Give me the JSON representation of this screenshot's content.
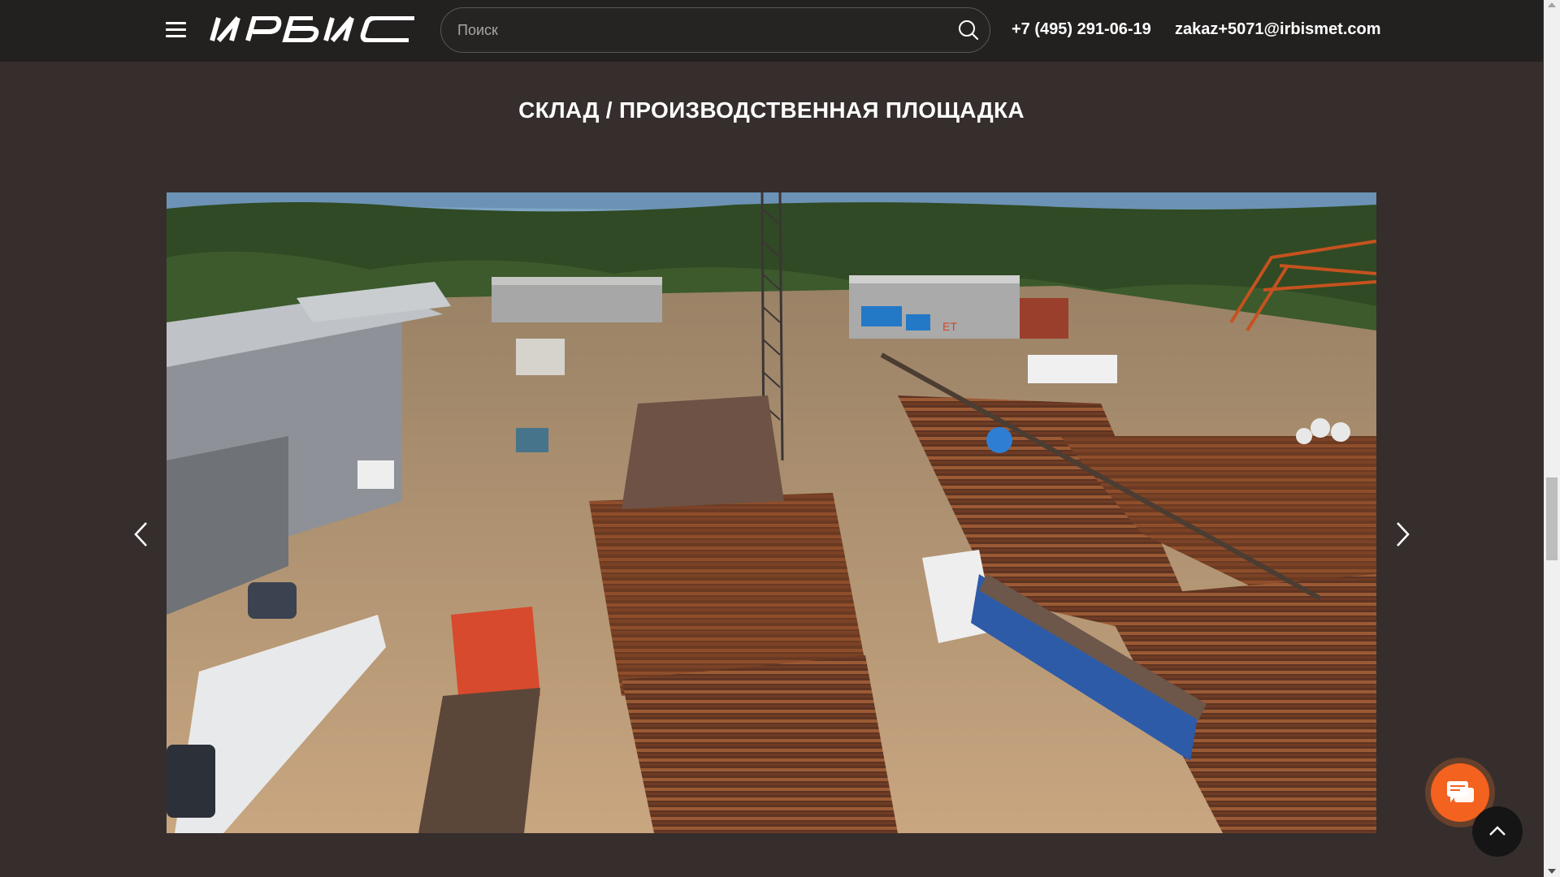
{
  "header": {
    "logo_text": "ИРБИС",
    "search": {
      "placeholder": "Поиск"
    },
    "phone": "+7 (495) 291-06-19",
    "email": "zakaz+5071@irbismet.com"
  },
  "section": {
    "title": "СКЛАД / ПРОИЗВОДСТВЕННАЯ ПЛОЩАДКА"
  },
  "slide": {
    "alt": "warehouse-aerial-photo",
    "building_sign": "ЕТ"
  },
  "icons": {
    "menu": "hamburger-icon",
    "search": "search-icon",
    "prev": "chevron-left-icon",
    "next": "chevron-right-icon",
    "chat": "chat-icon",
    "top": "chevron-up-icon"
  },
  "colors": {
    "page_bg": "#352e2d",
    "header_bg": "#232120",
    "accent": "#f4621f"
  }
}
